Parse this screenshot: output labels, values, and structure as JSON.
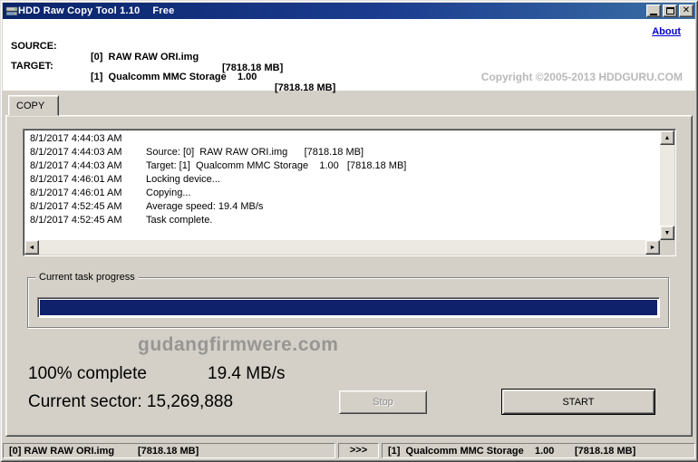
{
  "window": {
    "title": "HDD Raw Copy Tool 1.10",
    "badge": "Free",
    "about_link": "About",
    "copyright": "Copyright ©2005-2013 HDDGURU.COM"
  },
  "header": {
    "source_label": "SOURCE:",
    "source_value": "[0]  RAW RAW ORI.img",
    "source_size": "[7818.18 MB]",
    "target_label": "TARGET:",
    "target_value": "[1]  Qualcomm MMC Storage    1.00",
    "target_size": "[7818.18 MB]"
  },
  "tabs": {
    "copy": "COPY"
  },
  "log": {
    "lines": [
      {
        "time": "8/1/2017 4:44:03 AM",
        "message": ""
      },
      {
        "time": "8/1/2017 4:44:03 AM",
        "message": "Source: [0]  RAW RAW ORI.img      [7818.18 MB]"
      },
      {
        "time": "8/1/2017 4:44:03 AM",
        "message": "Target: [1]  Qualcomm MMC Storage    1.00   [7818.18 MB]"
      },
      {
        "time": "8/1/2017 4:46:01 AM",
        "message": "Locking device..."
      },
      {
        "time": "8/1/2017 4:46:01 AM",
        "message": "Copying..."
      },
      {
        "time": "8/1/2017 4:52:45 AM",
        "message": "Average speed: 19.4 MB/s"
      },
      {
        "time": "8/1/2017 4:52:45 AM",
        "message": "Task complete."
      }
    ]
  },
  "progress": {
    "group_label": "Current task progress",
    "percent": 100,
    "percent_text": "100% complete",
    "speed_text": "19.4 MB/s",
    "sector_text": "Current sector: 15,269,888"
  },
  "watermark": "gudangfirmwere.com",
  "buttons": {
    "stop": "Stop",
    "start": "START"
  },
  "statusbar": {
    "source_name": "[0] RAW RAW ORI.img",
    "source_size": "[7818.18 MB]",
    "arrows": ">>>",
    "target_name": "[1]  Qualcomm MMC Storage    1.00",
    "target_size": "[7818.18 MB]"
  }
}
